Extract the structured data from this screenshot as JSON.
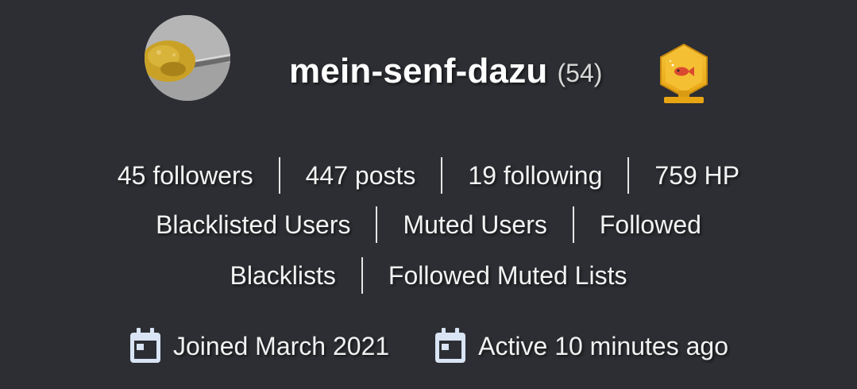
{
  "profile": {
    "username": "mein-senf-dazu",
    "reputation": "(54)",
    "avatar_icon": "avatar-image",
    "badge_icon": "fish-badge-icon",
    "colors": {
      "background": "#2c2e33",
      "text": "#ffffff",
      "badge": "#f0b21b",
      "calendar": "#d9e4f5"
    }
  },
  "stats": {
    "followers": "45 followers",
    "posts": "447 posts",
    "following": "19 following",
    "hp": "759 HP"
  },
  "lists": {
    "blacklisted_users": "Blacklisted Users",
    "muted_users": "Muted Users",
    "followed": "Followed",
    "blacklists": "Blacklists",
    "followed_muted_lists": "Followed Muted Lists"
  },
  "dates": {
    "joined": "Joined March 2021",
    "active": "Active 10 minutes ago",
    "icon": "calendar-icon"
  }
}
